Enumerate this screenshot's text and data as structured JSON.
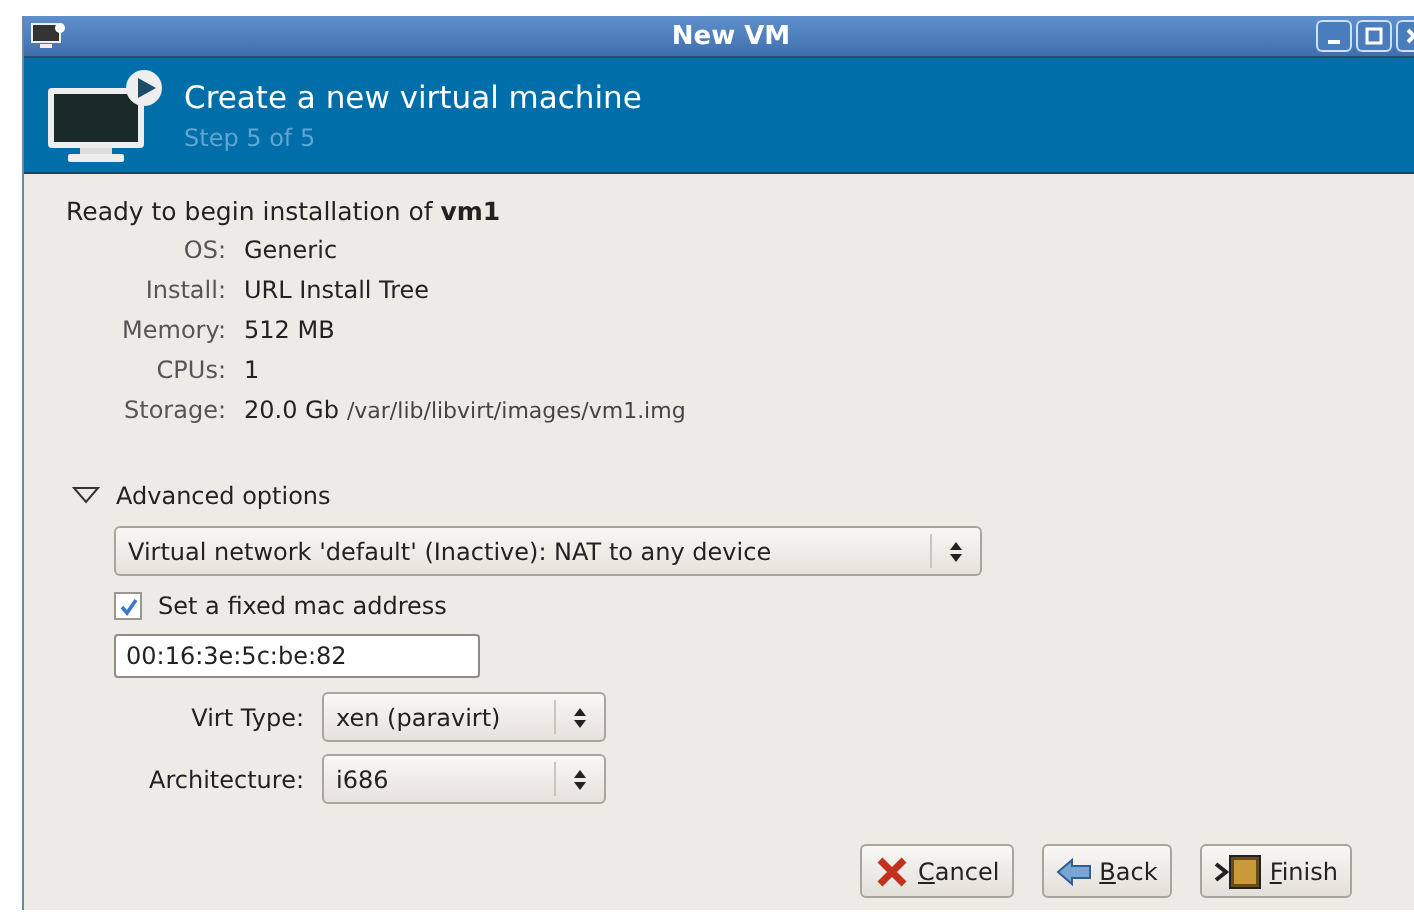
{
  "window": {
    "title": "New VM"
  },
  "header": {
    "title": "Create a new virtual machine",
    "subtitle": "Step 5 of 5"
  },
  "summary": {
    "intro": "Ready to begin installation of **vm1**",
    "rows": [
      {
        "label": "OS:",
        "value": "Generic"
      },
      {
        "label": "Install:",
        "value": "URL Install Tree"
      },
      {
        "label": "Memory:",
        "value": "512 MB"
      },
      {
        "label": "CPUs:",
        "value": "1"
      },
      {
        "label": "Storage:",
        "value": "20.0 Gb",
        "detail": "/var/lib/libvirt/images/vm1.img"
      }
    ]
  },
  "advanced": {
    "label": "Advanced options",
    "expanded": true,
    "network": "Virtual network 'default' (Inactive): NAT to any device",
    "fixed_mac": {
      "label": "Set a fixed mac address",
      "checked": true
    },
    "mac": "00:16:3e:5c:be:82",
    "selects": [
      {
        "label": "Virt Type:",
        "value": "xen (paravirt)"
      },
      {
        "label": "Architecture:",
        "value": "i686"
      }
    ]
  },
  "buttons": [
    {
      "kind": "cancel",
      "mnemonic": "C",
      "rest": "ancel"
    },
    {
      "kind": "back",
      "mnemonic": "B",
      "rest": "ack"
    },
    {
      "kind": "finish",
      "mnemonic": "F",
      "rest": "inish"
    }
  ]
}
